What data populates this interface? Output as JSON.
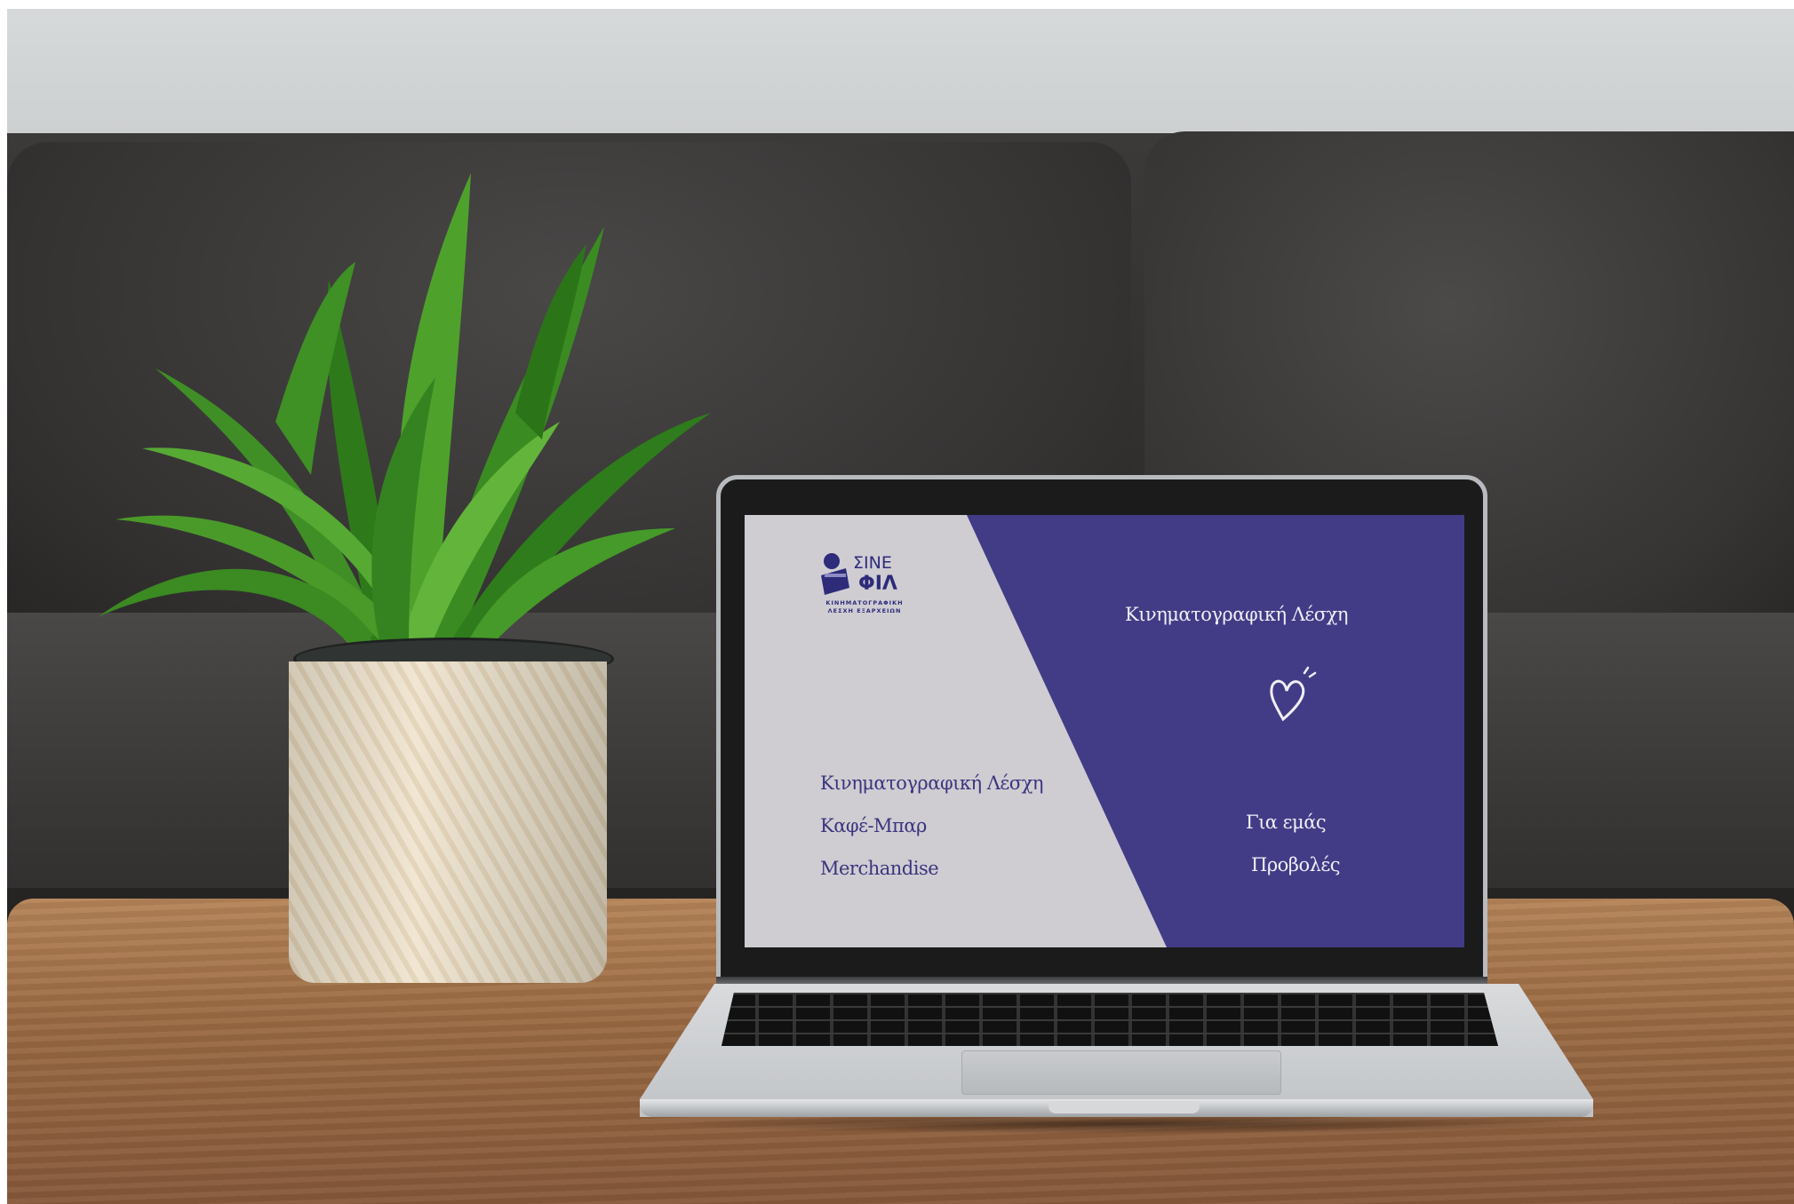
{
  "brand": {
    "logo_line1": "ΣΙΝΕ",
    "logo_line2": "ΦΙΛ",
    "logo_sub1": "ΚΙΝΗΜΑΤΟΓΡΑΦΙΚΗ",
    "logo_sub2": "ΛΕΣΧΗ ΕΞΑΡΧΕΙΩΝ"
  },
  "screen": {
    "headline": "Κινηματογραφική Λέσχη",
    "left_nav": [
      "Κινηματογραφική Λέσχη",
      "Καφέ-Μπαρ",
      "Merchandise"
    ],
    "right_nav": [
      "Για εμάς",
      "Προβολές"
    ]
  },
  "colors": {
    "purple": "#423c86",
    "light_panel": "#cfcdd2",
    "logo_navy": "#2d2b7a"
  },
  "icons": [
    "heart-icon"
  ]
}
